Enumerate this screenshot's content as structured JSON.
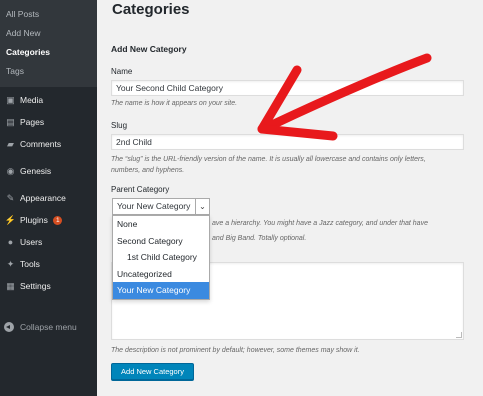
{
  "sidebar": {
    "submenu": [
      "All Posts",
      "Add New",
      "Categories",
      "Tags"
    ],
    "current_submenu": "Categories",
    "items": [
      {
        "label": "Media",
        "icon": "media-icon",
        "glyph": "▣"
      },
      {
        "label": "Pages",
        "icon": "pages-icon",
        "glyph": "▤"
      },
      {
        "label": "Comments",
        "icon": "comments-icon",
        "glyph": "▰"
      },
      {
        "label": "Genesis",
        "icon": "genesis-icon",
        "glyph": "◉"
      },
      {
        "label": "Appearance",
        "icon": "appearance-icon",
        "glyph": "✎"
      },
      {
        "label": "Plugins",
        "icon": "plugins-icon",
        "glyph": "⚡",
        "badge": "1"
      },
      {
        "label": "Users",
        "icon": "users-icon",
        "glyph": "●"
      },
      {
        "label": "Tools",
        "icon": "tools-icon",
        "glyph": "✦"
      },
      {
        "label": "Settings",
        "icon": "settings-icon",
        "glyph": "▦"
      }
    ],
    "collapse_label": "Collapse menu"
  },
  "page": {
    "title": "Categories",
    "section_title": "Add New Category"
  },
  "form": {
    "name_label": "Name",
    "name_value": "Your Second Child Category",
    "name_desc": "The name is how it appears on your site.",
    "slug_label": "Slug",
    "slug_value": "2nd Child",
    "slug_desc_1": "The “slug” is the URL-friendly version of the name. It is usually all lowercase and contains only letters,",
    "slug_desc_2": "numbers, and hyphens.",
    "parent_label": "Parent Category",
    "parent_selected": "Your New Category",
    "parent_options": [
      "None",
      "Second Category",
      "1st Child Category",
      "Uncategorized",
      "Your New Category"
    ],
    "parent_desc_1": "ave a hierarchy. You might have a Jazz category, and under that have",
    "parent_desc_2": "and Big Band. Totally optional.",
    "description_desc": "The description is not prominent by default; however, some themes may show it.",
    "submit_label": "Add New Category"
  },
  "colors": {
    "sidebar_bg": "#23282d",
    "submenu_bg": "#32373c",
    "primary_button": "#0085ba",
    "selected_option": "#3b8ae0",
    "annotation_arrow": "#e8191c"
  }
}
